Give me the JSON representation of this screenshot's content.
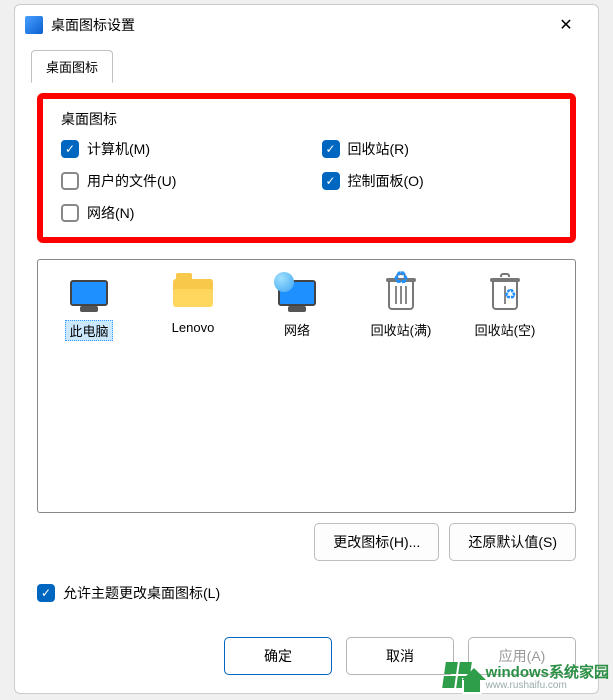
{
  "window": {
    "title": "桌面图标设置"
  },
  "tab": {
    "main": "桌面图标"
  },
  "group": {
    "label": "桌面图标"
  },
  "checks": {
    "computer": {
      "label": "计算机(M)",
      "checked": true
    },
    "recyclebin": {
      "label": "回收站(R)",
      "checked": true
    },
    "userfiles": {
      "label": "用户的文件(U)",
      "checked": false
    },
    "controlpanel": {
      "label": "控制面板(O)",
      "checked": true
    },
    "network": {
      "label": "网络(N)",
      "checked": false
    }
  },
  "icons": [
    {
      "key": "this-pc",
      "label": "此电脑",
      "selected": true
    },
    {
      "key": "lenovo",
      "label": "Lenovo",
      "selected": false
    },
    {
      "key": "network",
      "label": "网络",
      "selected": false
    },
    {
      "key": "recycle-full",
      "label": "回收站(满)",
      "selected": false
    },
    {
      "key": "recycle-empty",
      "label": "回收站(空)",
      "selected": false
    }
  ],
  "buttons": {
    "changeIcon": "更改图标(H)...",
    "restoreDefault": "还原默认值(S)",
    "ok": "确定",
    "cancel": "取消",
    "apply": "应用(A)"
  },
  "themeCheck": {
    "label": "允许主题更改桌面图标(L)",
    "checked": true
  },
  "watermark": {
    "line1": "windows系统家园",
    "line2": "www.rushaifu.com"
  }
}
